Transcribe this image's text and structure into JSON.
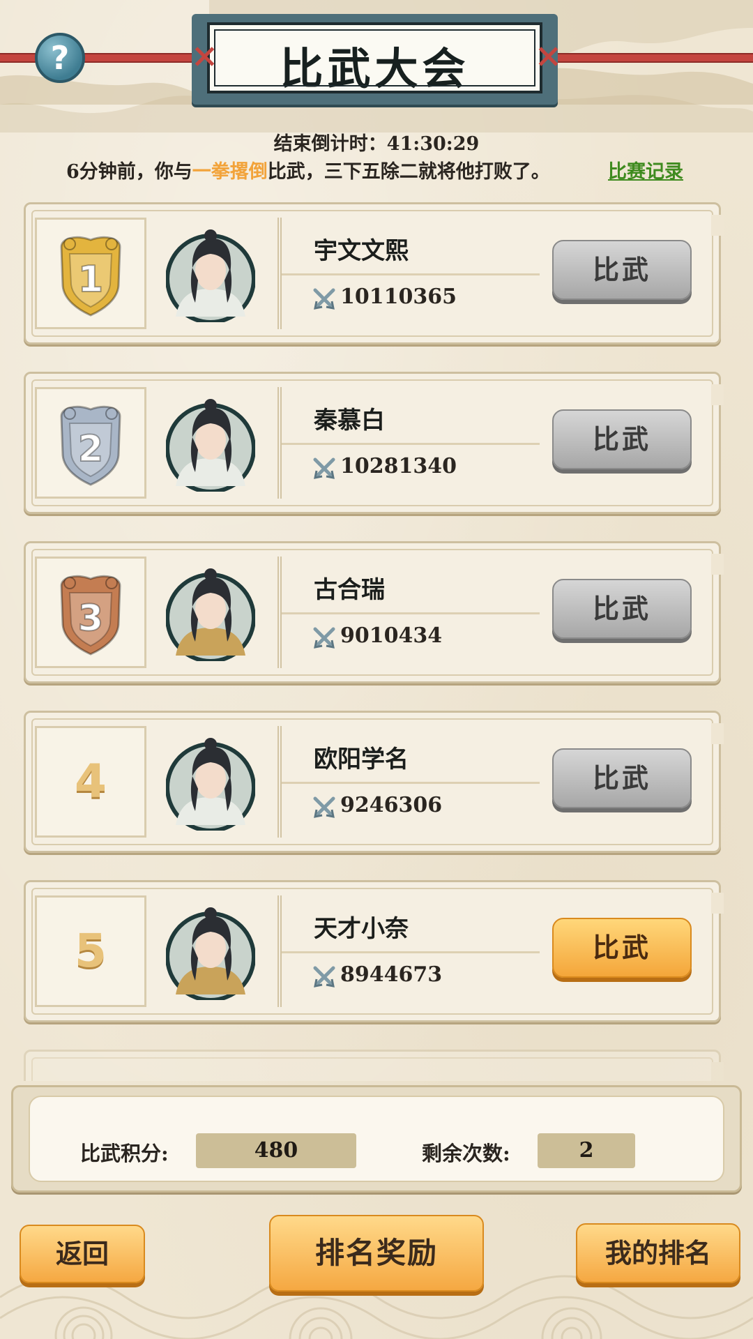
{
  "header": {
    "title": "比武大会",
    "help_icon": "question-mark-icon",
    "help_label": "?"
  },
  "countdown": {
    "label": "结束倒计时：",
    "value": "41:30:29"
  },
  "battle_message": {
    "prefix": "6分钟前，你与",
    "opponent": "一拳撂倒",
    "suffix": "比武，三下五除二就将他打败了。",
    "records_link": "比赛记录",
    "opponent_color": "#f2a33a",
    "link_color": "#3f8b1f"
  },
  "rankings": [
    {
      "rank": "1",
      "badge": "gold",
      "name": "宇文文熙",
      "power": "10110365",
      "button": "比武",
      "button_state": "disabled"
    },
    {
      "rank": "2",
      "badge": "silver",
      "name": "秦慕白",
      "power": "10281340",
      "button": "比武",
      "button_state": "disabled"
    },
    {
      "rank": "3",
      "badge": "bronze",
      "name": "古合瑞",
      "power": "9010434",
      "button": "比武",
      "button_state": "disabled"
    },
    {
      "rank": "4",
      "badge": "none",
      "name": "欧阳学名",
      "power": "9246306",
      "button": "比武",
      "button_state": "disabled"
    },
    {
      "rank": "5",
      "badge": "none",
      "name": "天才小奈",
      "power": "8944673",
      "button": "比武",
      "button_state": "active"
    }
  ],
  "stats": {
    "score_label": "比武积分:",
    "score_value": "480",
    "remaining_label": "剩余次数:",
    "remaining_value": "2"
  },
  "buttons": {
    "back": "返回",
    "rewards": "排名奖励",
    "my_rank": "我的排名"
  },
  "colors": {
    "badge_gold": "#e3b43e",
    "badge_silver": "#a9b6c7",
    "badge_bronze": "#c47d52",
    "button_active": "#f4a63a",
    "button_disabled": "#a7a7a7"
  }
}
